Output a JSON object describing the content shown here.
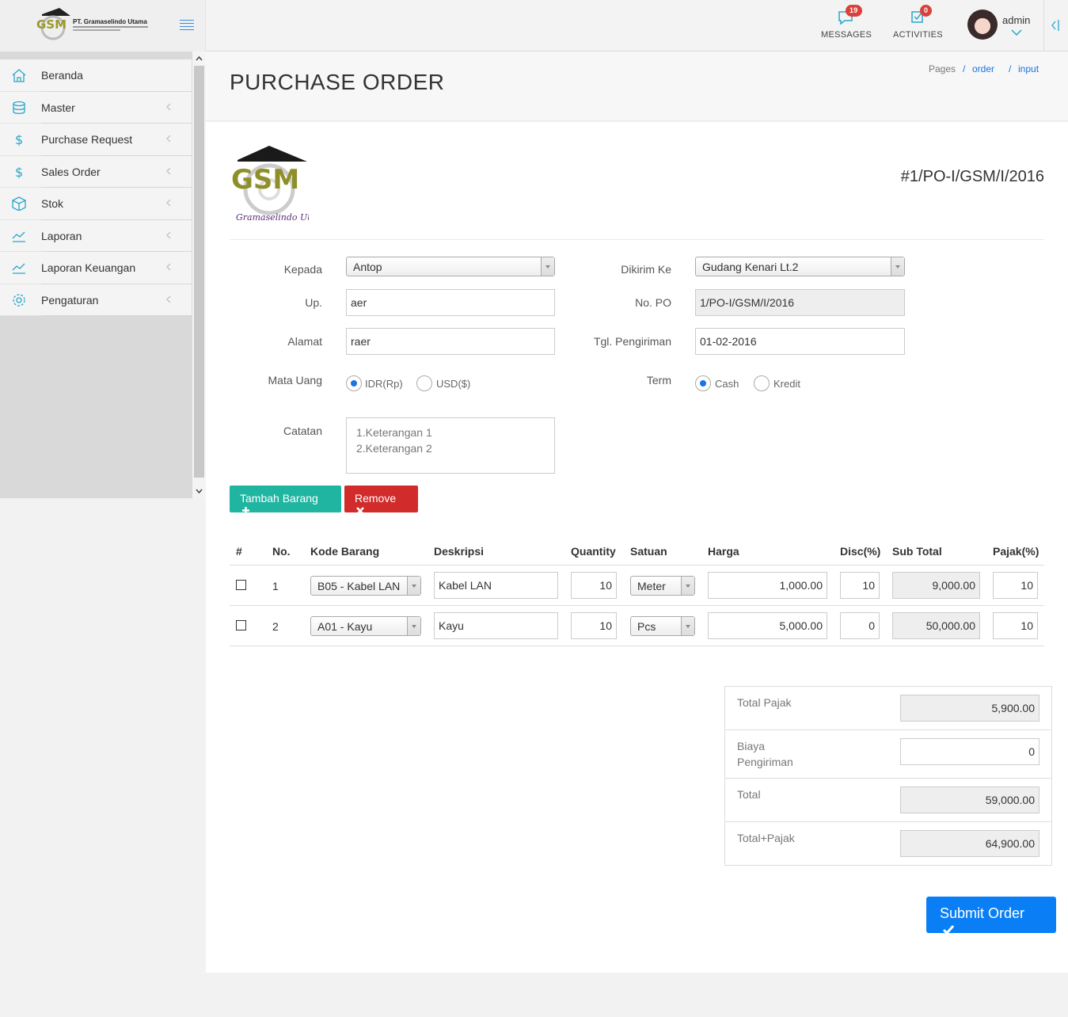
{
  "brand": {
    "logo_text": "GSM",
    "name": "PT. Gramaselindo Utama"
  },
  "topbar": {
    "messages_label": "MESSAGES",
    "messages_count": "19",
    "activities_label": "ACTIVITIES",
    "activities_count": "0",
    "user_name": "admin"
  },
  "sidebar": {
    "items": [
      {
        "label": "Beranda",
        "icon": "home-icon"
      },
      {
        "label": "Master",
        "icon": "database-icon"
      },
      {
        "label": "Purchase Request",
        "icon": "dollar-icon"
      },
      {
        "label": "Sales Order",
        "icon": "dollar-icon"
      },
      {
        "label": "Stok",
        "icon": "box-icon"
      },
      {
        "label": "Laporan",
        "icon": "chart-line-icon"
      },
      {
        "label": "Laporan Keuangan",
        "icon": "chart-line-icon"
      },
      {
        "label": "Pengaturan",
        "icon": "gear-icon"
      }
    ]
  },
  "page": {
    "title": "PURCHASE ORDER",
    "breadcrumb": [
      "Pages",
      "order",
      "input"
    ]
  },
  "po": {
    "logo_text": "GSM",
    "logo_subtitle": "Gramaselindo Utama",
    "number": "#1/PO-I/GSM/I/2016"
  },
  "form": {
    "kepada_label": "Kepada",
    "kepada_value": "Antop",
    "up_label": "Up.",
    "up_value": "aer",
    "alamat_label": "Alamat",
    "alamat_value": "raer",
    "mata_uang_label": "Mata Uang",
    "currency_options": [
      "IDR(Rp)",
      "USD($)"
    ],
    "currency_selected": "IDR(Rp)",
    "catatan_label": "Catatan",
    "catatan_lines": [
      "1.Keterangan 1",
      "2.Keterangan 2"
    ],
    "dikirim_label": "Dikirim Ke",
    "dikirim_value": "Gudang Kenari Lt.2",
    "no_po_label": "No. PO",
    "no_po_value": "1/PO-I/GSM/I/2016",
    "tgl_label": "Tgl. Pengiriman",
    "tgl_value": "01-02-2016",
    "term_label": "Term",
    "term_options": [
      "Cash",
      "Kredit"
    ],
    "term_selected": "Cash"
  },
  "buttons": {
    "tambah": "Tambah Barang",
    "remove": "Remove",
    "submit": "Submit Order"
  },
  "table": {
    "headers": [
      "#",
      "No.",
      "Kode Barang",
      "Deskripsi",
      "Quantity",
      "Satuan",
      "Harga",
      "Disc(%)",
      "Sub Total",
      "Pajak(%)"
    ],
    "rows": [
      {
        "no": "1",
        "kode": "B05 - Kabel LAN",
        "deskripsi": "Kabel LAN",
        "qty": "10",
        "satuan": "Meter",
        "harga": "1,000.00",
        "disc": "10",
        "subtotal": "9,000.00",
        "pajak": "10"
      },
      {
        "no": "2",
        "kode": "A01 - Kayu",
        "deskripsi": "Kayu",
        "qty": "10",
        "satuan": "Pcs",
        "harga": "5,000.00",
        "disc": "0",
        "subtotal": "50,000.00",
        "pajak": "10"
      }
    ]
  },
  "summary": {
    "total_pajak_label": "Total Pajak",
    "total_pajak": "5,900.00",
    "biaya_label_1": "Biaya",
    "biaya_label_2": "Pengiriman",
    "biaya": "0",
    "total_label": "Total",
    "total": "59,000.00",
    "total_pajak_all_label": "Total+Pajak",
    "total_pajak_all": "64,900.00"
  },
  "colors": {
    "primary": "#0a7ff5",
    "teal": "#1fb5a0",
    "danger": "#d12b2b",
    "link": "#1a73e8",
    "sidebar_icon": "#2aa6c9"
  }
}
